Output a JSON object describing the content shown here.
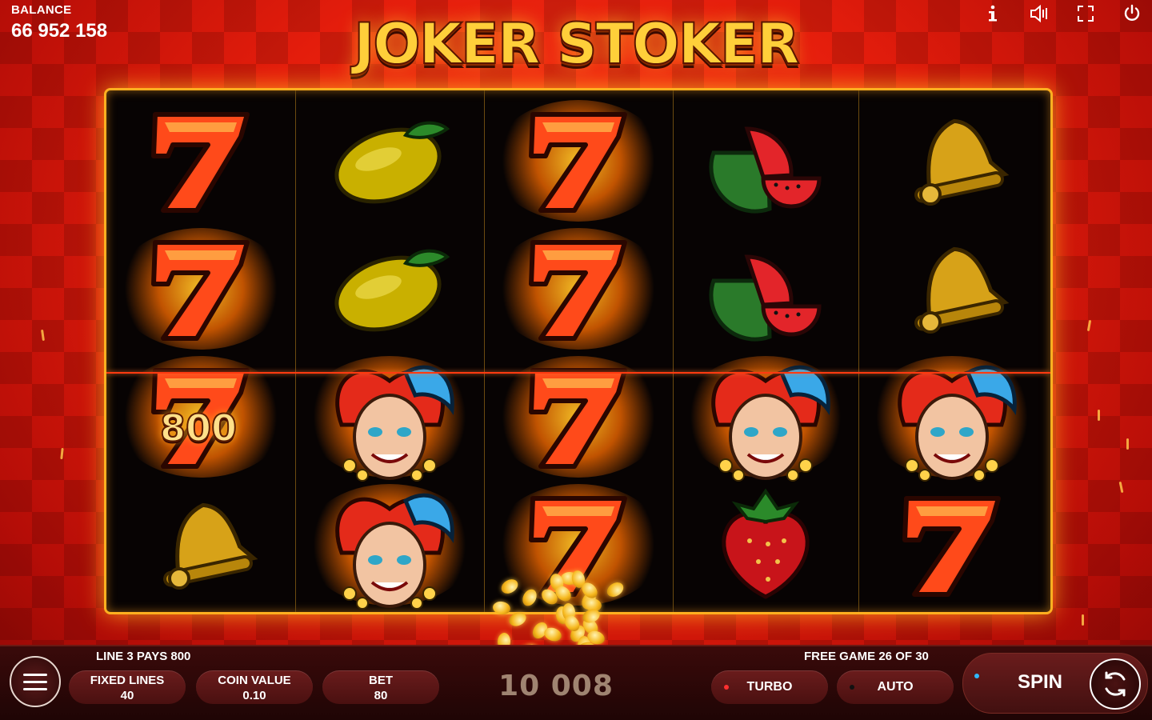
{
  "header": {
    "balance_label": "BALANCE",
    "balance_value": "66 952 158",
    "game_title": "JOKER STOKER",
    "icons": [
      "info-icon",
      "sound-icon",
      "fullscreen-icon",
      "power-icon"
    ]
  },
  "reels": [
    [
      "seven",
      "seven",
      "seven",
      "bell"
    ],
    [
      "lemon",
      "lemon",
      "joker",
      "joker"
    ],
    [
      "seven",
      "seven",
      "seven",
      "seven"
    ],
    [
      "watermelon",
      "watermelon",
      "joker",
      "strawberry"
    ],
    [
      "bell",
      "bell",
      "joker",
      "seven"
    ]
  ],
  "winning_cells": [
    [
      0,
      1
    ],
    [
      0,
      2
    ],
    [
      1,
      2
    ],
    [
      1,
      3
    ],
    [
      2,
      0
    ],
    [
      2,
      1
    ],
    [
      2,
      2
    ],
    [
      2,
      3
    ],
    [
      3,
      2
    ],
    [
      4,
      2
    ]
  ],
  "reel_win_value": "800",
  "footer": {
    "line_info": "LINE 3 PAYS 800",
    "free_game_info": "FREE GAME 26 OF 30",
    "fixed_lines_label": "FIXED LINES",
    "fixed_lines_value": "40",
    "coin_value_label": "COIN VALUE",
    "coin_value_value": "0.10",
    "bet_label": "BET",
    "bet_value": "80",
    "win_total": "10 008",
    "turbo_label": "TURBO",
    "auto_label": "AUTO",
    "spin_label": "SPIN"
  },
  "colors": {
    "background": "#e41d0c",
    "frame": "#ffb020",
    "turbo_dot": "#ff3030",
    "auto_dot": "#111111",
    "spin_dot": "#2fb8ff"
  }
}
